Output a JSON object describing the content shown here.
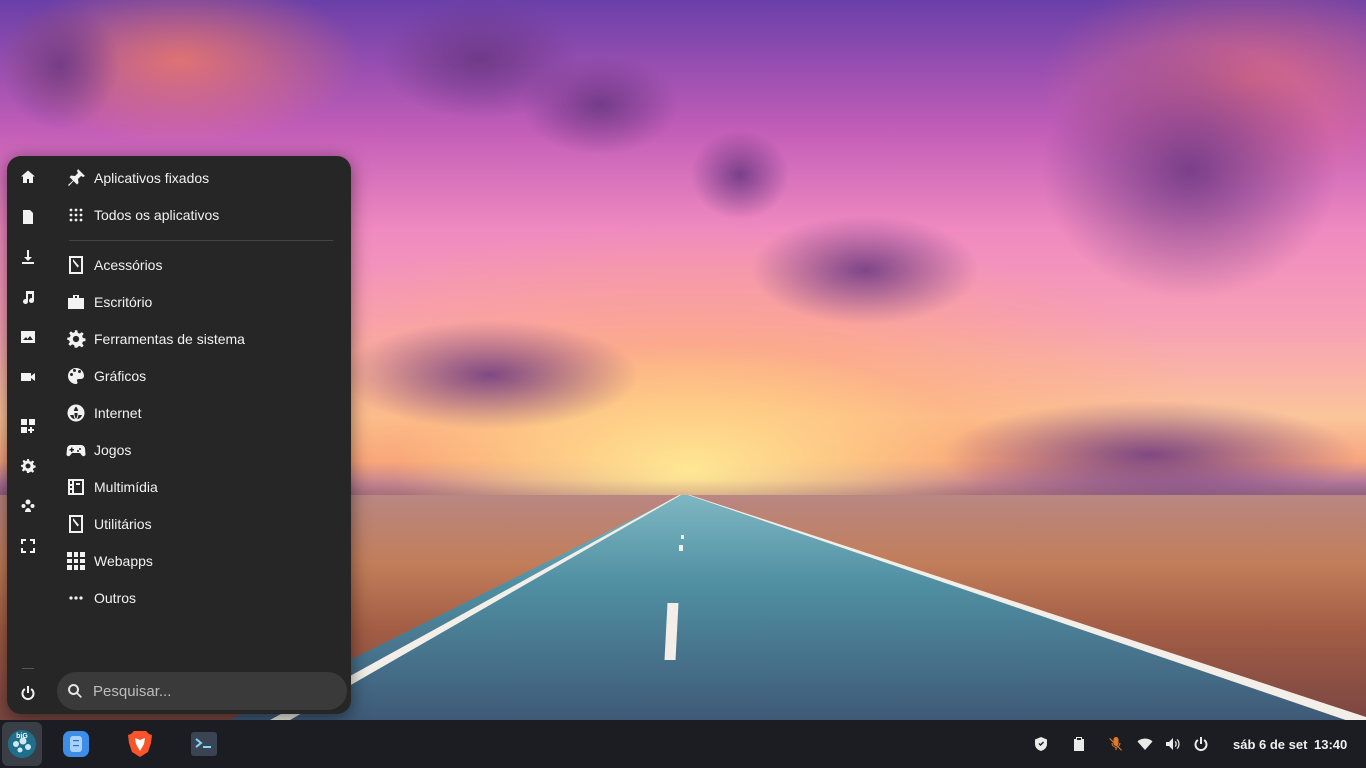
{
  "menu": {
    "rail_icons": [
      "home-icon",
      "document-icon",
      "download-icon",
      "music-icon",
      "image-icon",
      "video-icon",
      "apps-add-icon",
      "settings-icon",
      "users-icon",
      "fullscreen-icon",
      "power-icon"
    ],
    "sections": [
      {
        "label": "Aplicativos fixados",
        "icon": "pin-icon"
      },
      {
        "label": "Todos os aplicativos",
        "icon": "grid-dots-icon"
      }
    ],
    "categories": [
      {
        "label": "Acessórios",
        "icon": "accessories-icon"
      },
      {
        "label": "Escritório",
        "icon": "office-icon"
      },
      {
        "label": "Ferramentas de sistema",
        "icon": "gear-icon"
      },
      {
        "label": "Gráficos",
        "icon": "graphics-icon"
      },
      {
        "label": "Internet",
        "icon": "globe-icon"
      },
      {
        "label": "Jogos",
        "icon": "gamepad-icon"
      },
      {
        "label": "Multimídia",
        "icon": "multimedia-icon"
      },
      {
        "label": "Utilitários",
        "icon": "utilities-icon"
      },
      {
        "label": "Webapps",
        "icon": "webapps-icon"
      },
      {
        "label": "Outros",
        "icon": "more-icon"
      }
    ],
    "search": {
      "placeholder": "Pesquisar..."
    }
  },
  "taskbar": {
    "apps": [
      {
        "name": "BigLinux menu",
        "icon": "biglinux-logo-icon",
        "active": true
      },
      {
        "name": "Files",
        "icon": "file-manager-icon"
      },
      {
        "name": "Brave",
        "icon": "brave-browser-icon"
      },
      {
        "name": "Terminal",
        "icon": "terminal-icon"
      }
    ],
    "tray": [
      "shield-icon",
      "clipboard-icon",
      "mic-muted-icon",
      "wifi-icon",
      "volume-icon",
      "power-icon"
    ],
    "date": "sáb 6 de set",
    "time": "13:40"
  },
  "colors": {
    "menu_bg": "#262626",
    "taskbar_bg": "#1b1d22",
    "mic_muted": "#e07a2a"
  }
}
